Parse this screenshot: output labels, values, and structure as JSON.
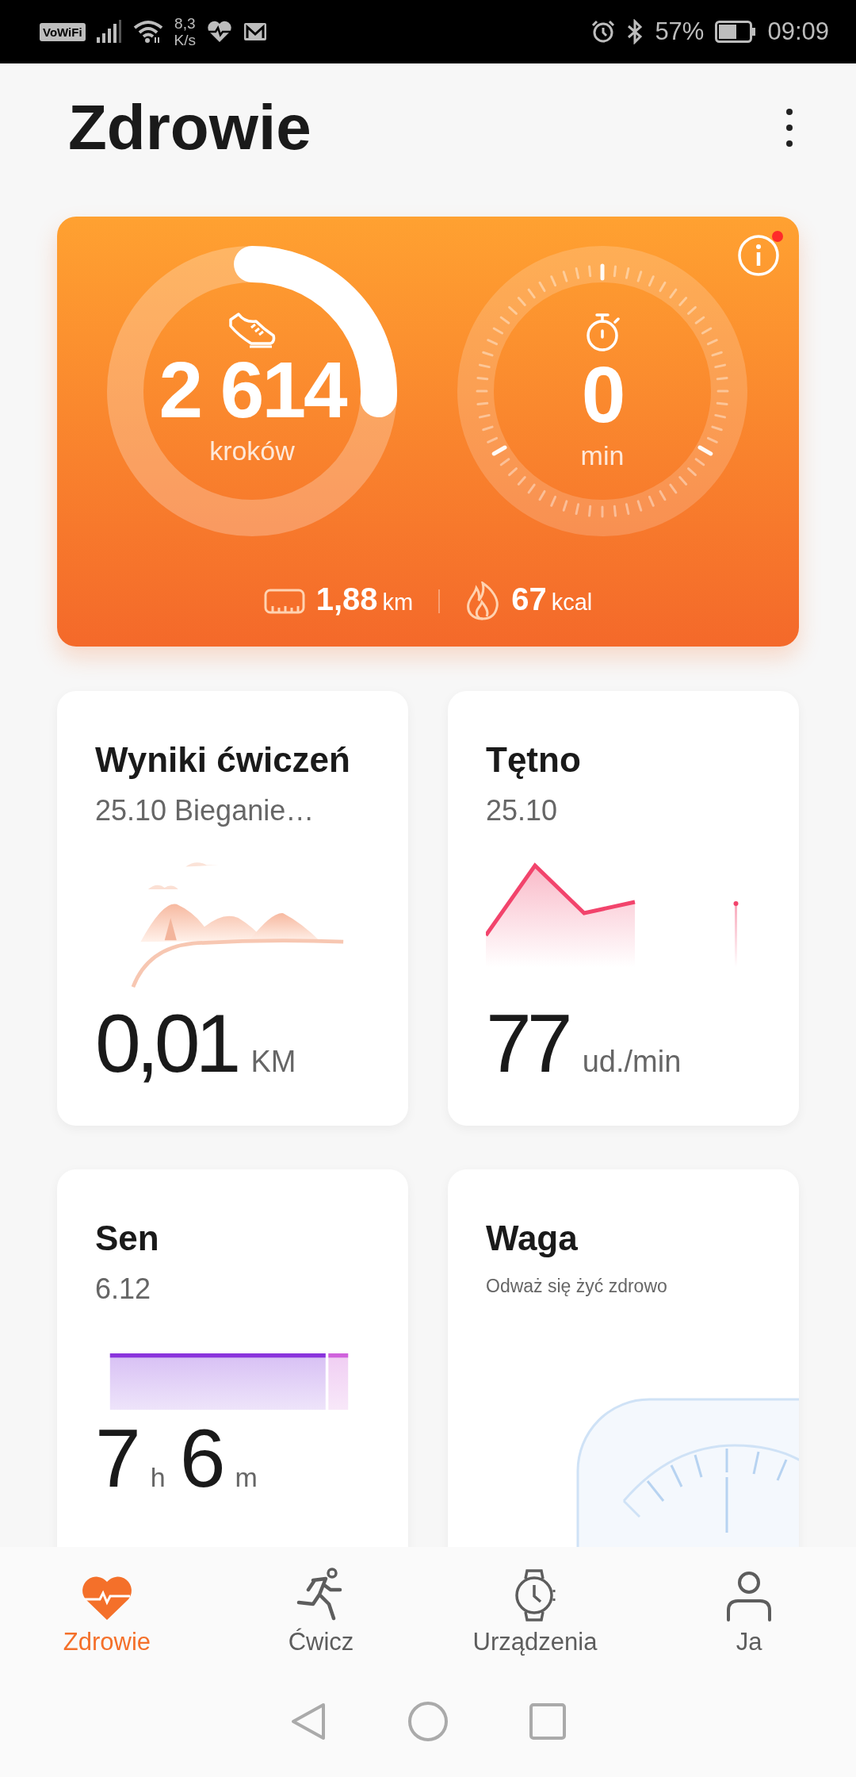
{
  "status_bar": {
    "vowifi": "VoWiFi",
    "speed_value": "8,3",
    "speed_unit": "K/s",
    "battery": "57%",
    "time": "09:09"
  },
  "header": {
    "title": "Zdrowie"
  },
  "activity": {
    "info_button": {
      "notification": true
    },
    "steps": {
      "value": "2 614",
      "unit": "kroków",
      "level": 0.26
    },
    "active_time": {
      "value": "0",
      "unit": "min"
    },
    "distance": {
      "value": "1,88",
      "unit": "km"
    },
    "calories": {
      "value": "67",
      "unit": "kcal"
    }
  },
  "cards": [
    {
      "kind": "exercise",
      "title": "Wyniki ćwiczeń",
      "subtitle": "25.10 Bieganie…",
      "value": "0,01",
      "unit": "KM"
    },
    {
      "kind": "heart",
      "title": "Tętno",
      "subtitle": "25.10",
      "value": "77",
      "unit": "ud./min"
    },
    {
      "kind": "sleep",
      "title": "Sen",
      "subtitle": "6.12",
      "parts": [
        {
          "value": "7",
          "unit": "h"
        },
        {
          "value": "6",
          "unit": "m"
        }
      ]
    },
    {
      "kind": "weight",
      "title": "Waga",
      "subtitle": "Odważ się żyć zdrowo"
    }
  ],
  "nav": [
    {
      "label": "Zdrowie",
      "selected": true
    },
    {
      "label": "Ćwicz",
      "selected": false
    },
    {
      "label": "Urządzenia",
      "selected": false
    },
    {
      "label": "Ja",
      "selected": false
    }
  ]
}
